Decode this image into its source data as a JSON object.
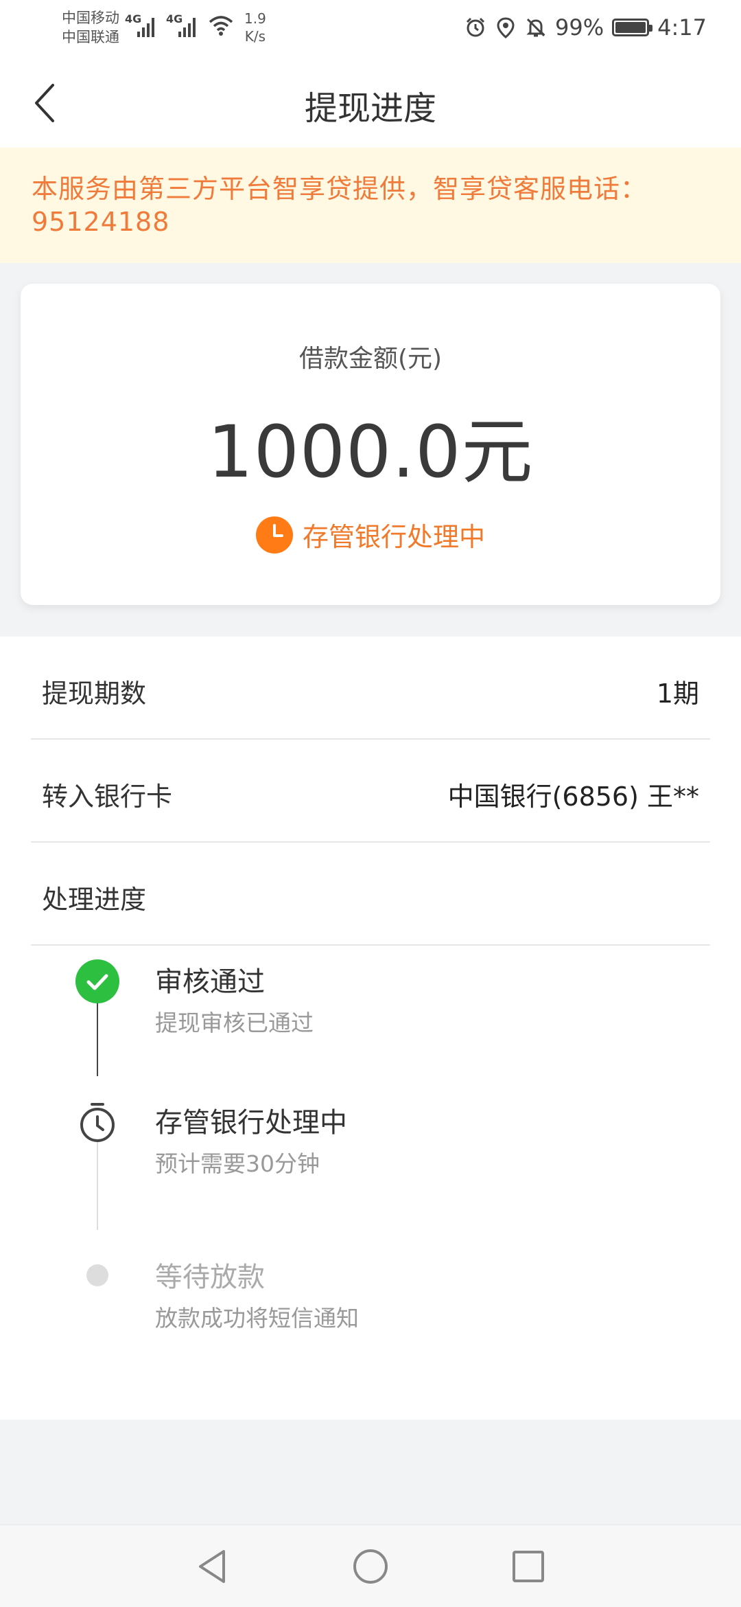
{
  "status_bar": {
    "carrier_1": "中国移动",
    "carrier_2": "中国联通",
    "network_1": "4G",
    "network_2": "4G",
    "speed_value": "1.9",
    "speed_unit": "K/s",
    "battery": "99%",
    "time": "4:17",
    "icons": [
      "alarm-icon",
      "location-icon",
      "bell-off-icon",
      "battery-icon"
    ]
  },
  "nav": {
    "title": "提现进度"
  },
  "notice": {
    "text": "本服务由第三方平台智享贷提供，智享贷客服电话：95124188"
  },
  "amount_card": {
    "label": "借款金额(元)",
    "value": "1000.0元",
    "status": "存管银行处理中",
    "accent_color": "#ff7b15"
  },
  "details": {
    "rows": [
      {
        "label": "提现期数",
        "value": "1期"
      },
      {
        "label": "转入银行卡",
        "value": "中国银行(6856)  王**"
      },
      {
        "label": "处理进度",
        "value": ""
      }
    ]
  },
  "timeline": {
    "steps": [
      {
        "title": "审核通过",
        "subtitle": "提现审核已通过",
        "state": "done"
      },
      {
        "title": "存管银行处理中",
        "subtitle": "预计需要30分钟",
        "state": "current"
      },
      {
        "title": "等待放款",
        "subtitle": "放款成功将短信通知",
        "state": "pending"
      }
    ],
    "done_color": "#2dbf3f"
  },
  "system_nav": {
    "icons": [
      "back-triangle-icon",
      "home-circle-icon",
      "recents-square-icon"
    ]
  }
}
